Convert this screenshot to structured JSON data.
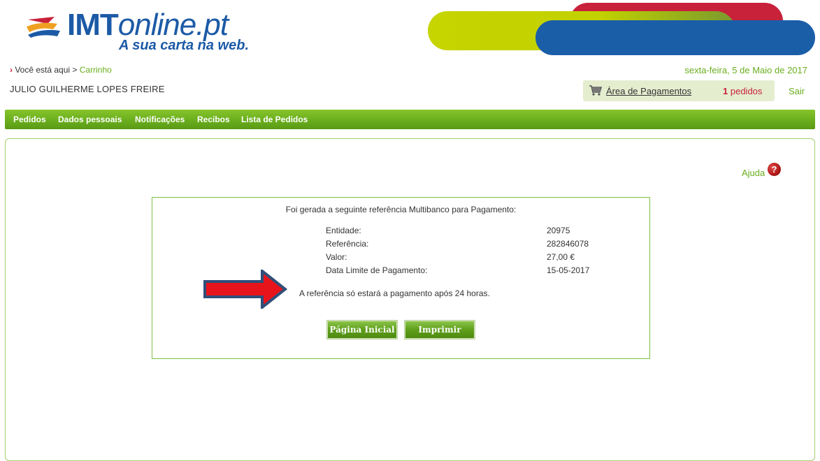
{
  "header": {
    "logo_main": "IMT",
    "logo_italic": "online.pt",
    "logo_tagline": "A sua carta na web.",
    "breadcrumb_prefix": "Você está aqui >",
    "breadcrumb_current": "Carrinho",
    "date": "sexta-feira, 5 de Maio de 2017",
    "user_name": "JULIO GUILHERME LOPES FREIRE",
    "payments_link": "Área de Pagamentos",
    "orders_count": "1",
    "orders_label": "pedidos",
    "logout": "Sair"
  },
  "menu": {
    "items": [
      "Pedidos",
      "Dados pessoais",
      "Notificações",
      "Recibos",
      "Lista de Pedidos"
    ]
  },
  "help": {
    "label": "Ajuda",
    "icon_glyph": "?"
  },
  "payment": {
    "title": "Foi gerada a seguinte referência Multibanco para Pagamento:",
    "rows": [
      {
        "label": "Entidade:",
        "value": "20975"
      },
      {
        "label": "Referência:",
        "value": "282846078"
      },
      {
        "label": "Valor:",
        "value": "27,00 €"
      },
      {
        "label": "Data Limite de Pagamento:",
        "value": "15-05-2017"
      }
    ],
    "note": "A referência só estará a pagamento após 24 horas.",
    "btn_home": "Página Inicial",
    "btn_print": "Imprimir"
  },
  "colors": {
    "brand_green": "#6aae1e",
    "brand_blue": "#1a5ea8",
    "brand_red": "#c8213a",
    "arrow_fill": "#e8141c",
    "arrow_stroke": "#2f4f7a"
  },
  "icons": {
    "cart": "cart-icon",
    "help": "help-icon",
    "annotation_arrow": "arrow-icon"
  }
}
